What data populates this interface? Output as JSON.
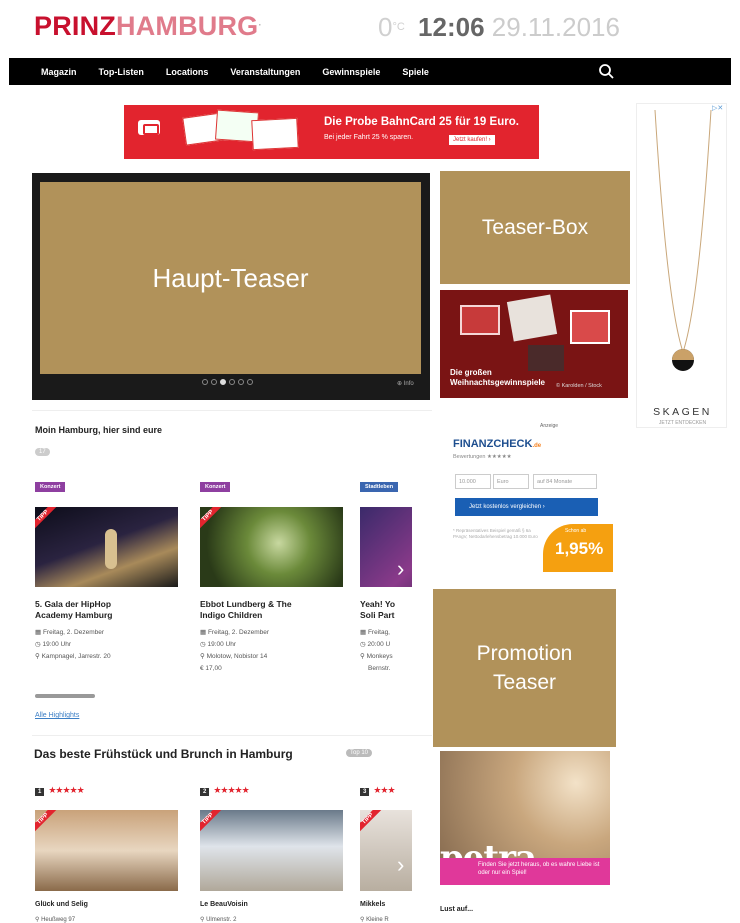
{
  "header": {
    "logo_bold": "PRINZ",
    "logo_light": "HAMBURG",
    "temperature": "0",
    "temp_unit": "°C",
    "time": "12:06",
    "date": "29.11.2016"
  },
  "nav": {
    "items": [
      "Magazin",
      "Top-Listen",
      "Locations",
      "Veranstaltungen",
      "Gewinnspiele",
      "Spiele"
    ]
  },
  "banner": {
    "headline": "Die Probe BahnCard 25 für 19 Euro.",
    "sub": "Bei jeder Fahrt 25 % sparen.",
    "button": "Jetzt kaufen! ›"
  },
  "haupt_teaser": {
    "label": "Haupt-Teaser",
    "info": "⊕ Info"
  },
  "teaser_box": {
    "label": "Teaser-Box"
  },
  "xmas_teaser": {
    "line1": "Die großen",
    "line2": "Weihnachtsgewinnspiele",
    "source": "© Karolden / Stock"
  },
  "skagen_ad": {
    "brand": "SKAGEN",
    "sub": "JETZT ENTDECKEN"
  },
  "section_events": {
    "title": "Moin Hamburg, hier sind eure",
    "count": "17",
    "link": "Alle Highlights",
    "events": [
      {
        "category": "Konzert",
        "tip": "TIPP",
        "title_line1": "5. Gala der HipHop",
        "title_line2": "Academy Hamburg",
        "date": "Freitag, 2. Dezember",
        "time": "19:00 Uhr",
        "venue": "Kampnagel, Jarrestr. 20",
        "price": ""
      },
      {
        "category": "Konzert",
        "tip": "TIPP",
        "title_line1": "Ebbot Lundberg & The",
        "title_line2": "Indigo Children",
        "date": "Freitag, 2. Dezember",
        "time": "19:00 Uhr",
        "venue": "Molotow, Nobistor 14",
        "price": "€ 17,00"
      },
      {
        "category": "Stadtleben",
        "tip": "",
        "title_line1": "Yeah! Yo",
        "title_line2": "Soli Part",
        "date": "Freitag,",
        "time": "20:00 U",
        "venue": "Monkeys",
        "venue2": "Bernstr."
      }
    ]
  },
  "finanzcheck_ad": {
    "label": "Anzeige",
    "brand": "FINANZCHECK",
    "brand_suffix": ".de",
    "rating": "Bewertungen ★★★★★",
    "amount": "10.000",
    "currency": "Euro",
    "term": "auf 84 Monate",
    "button": "Jetzt kostenlos vergleichen ›",
    "offer_label": "Schon ab",
    "offer_rate": "1,95%",
    "small": "* Repräsentatives Beispiel gemäß § 6a PAngV, Nettodarlehensbetrag 10.000 Euro"
  },
  "promotion": {
    "line1": "Promotion",
    "line2": "Teaser"
  },
  "petra_ad": {
    "logo": "petra",
    "text": "Finden Sie jetzt heraus, ob es wahre Liebe ist oder nur ein Spiel!"
  },
  "lust": "Lust auf...",
  "section_brunch": {
    "title": "Das beste Frühstück und Brunch in Hamburg",
    "badge": "Top 10",
    "items": [
      {
        "rank": "1",
        "stars": "★★★★★",
        "tip": "TIPP",
        "name": "Glück und Selig",
        "address": "Heußweg 97"
      },
      {
        "rank": "2",
        "stars": "★★★★★",
        "tip": "TIPP",
        "name": "Le BeauVoisin",
        "address": "Ulmenstr. 2"
      },
      {
        "rank": "3",
        "stars": "★★★",
        "tip": "TIPP",
        "name": "Mikkels",
        "address": "Kleine R"
      }
    ]
  },
  "colors": {
    "brand_red": "#c8102e",
    "placeholder_gold": "#b1925a",
    "nav_bg": "#000000"
  }
}
